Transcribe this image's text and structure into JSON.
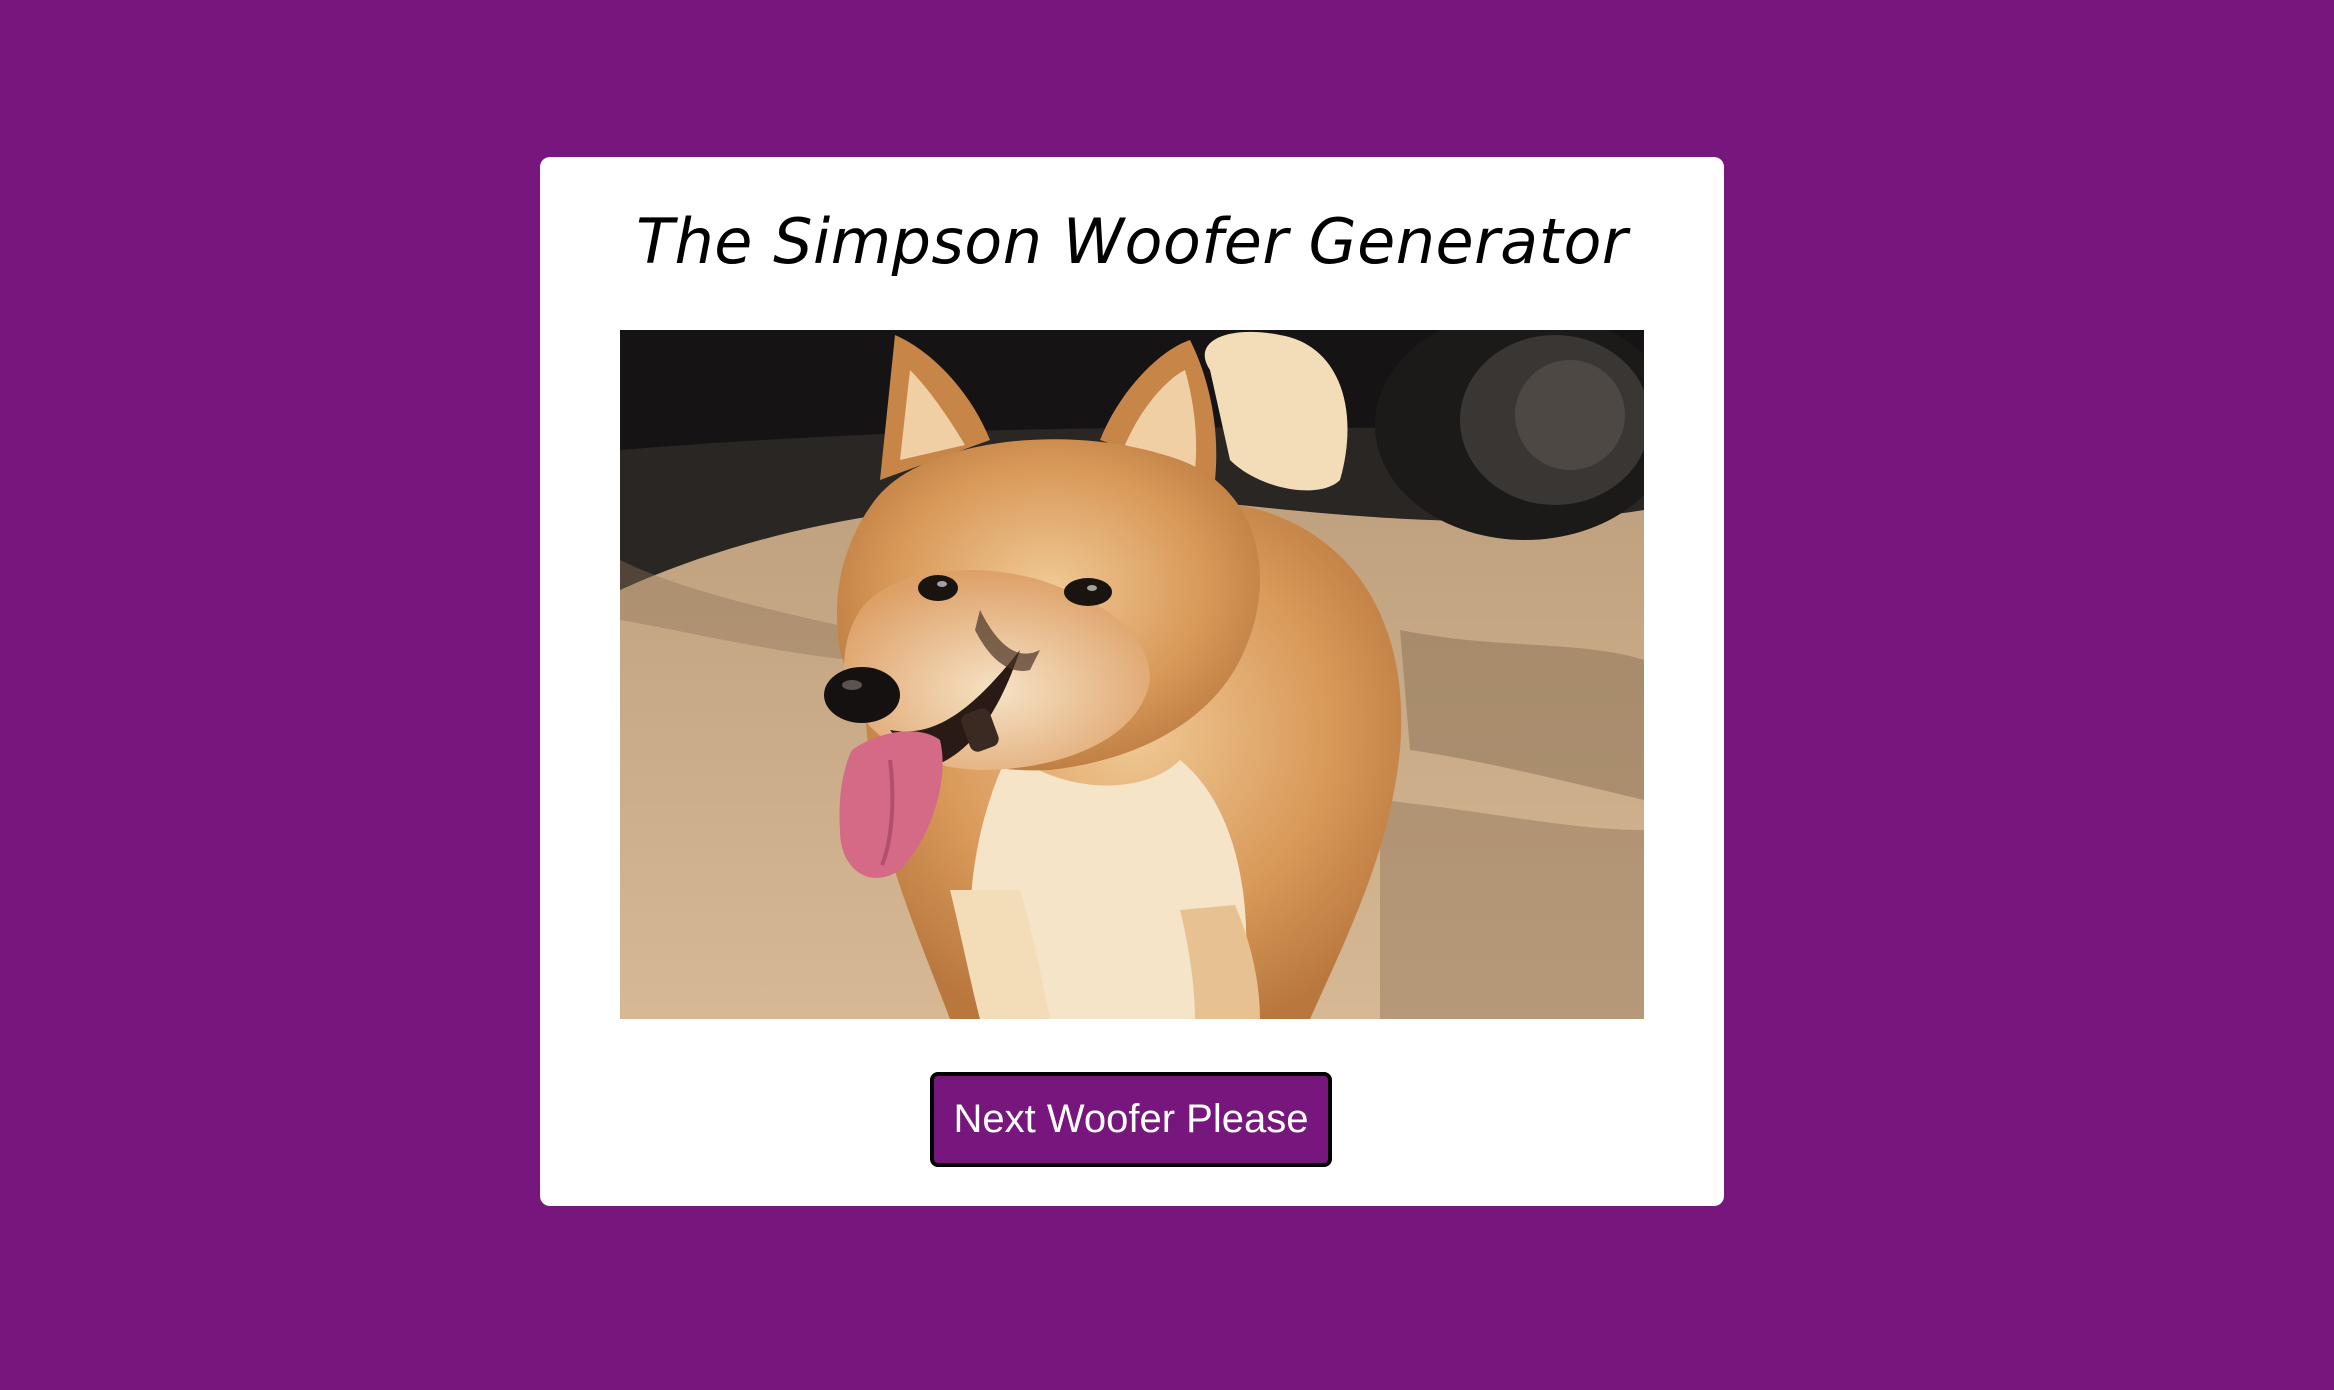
{
  "page": {
    "background_color": "#77167d"
  },
  "card": {
    "title": "The Simpson Woofer Generator",
    "image": {
      "subject_icon": "shiba-inu-dog-photo"
    },
    "button": {
      "label": "Next Woofer Please",
      "background_color": "#77167d",
      "text_color": "#ffffff",
      "border_color": "#000000"
    }
  }
}
